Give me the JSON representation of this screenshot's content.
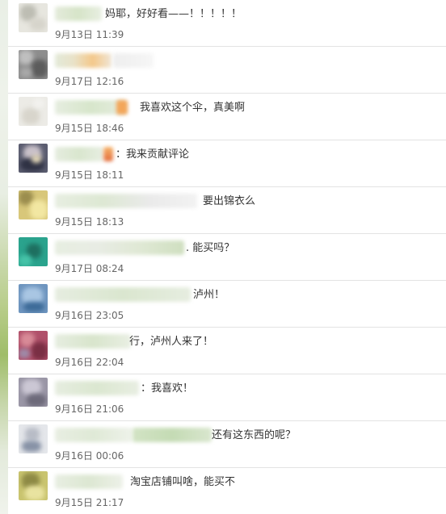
{
  "comments": [
    {
      "text": "妈耶，好好看——！！！！！",
      "time": "9月13日 11:39"
    },
    {
      "text": "",
      "time": "9月17日 12:16"
    },
    {
      "text": "我喜欢这个伞，真美啊",
      "time": "9月15日 18:46"
    },
    {
      "text": "：我来贡献评论",
      "time": "9月15日 18:11"
    },
    {
      "text": "要出锦衣么",
      "time": "9月15日 18:13"
    },
    {
      "text": ". 能买吗？",
      "time": "9月17日 08:24"
    },
    {
      "text": "泸州！",
      "time": "9月16日 23:05"
    },
    {
      "text": "行，泸州人来了！",
      "time": "9月16日 22:04"
    },
    {
      "text": "：我喜欢！",
      "time": "9月16日 21:06"
    },
    {
      "text": "还有这东西的呢？",
      "time": "9月16日 00:06"
    },
    {
      "text": "淘宝店铺叫啥，能买不",
      "time": "9月15日 21:17"
    }
  ]
}
